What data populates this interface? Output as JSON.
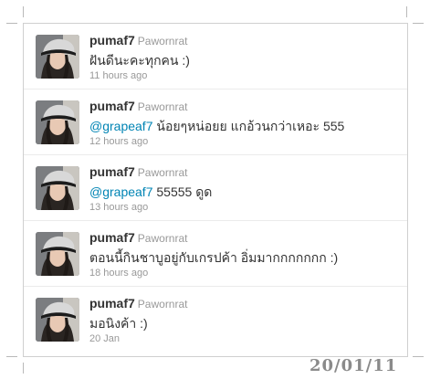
{
  "tweets": [
    {
      "username": "pumaf7",
      "full_name": "Pawornrat",
      "mention": "",
      "text": "ฝันดีนะคะทุกคน :)",
      "time": "11 hours ago"
    },
    {
      "username": "pumaf7",
      "full_name": "Pawornrat",
      "mention": "@grapeaf7",
      "text": " น้อยๆหน่อยย แกอ้วนกว่าเหอะ 555",
      "time": "12 hours ago"
    },
    {
      "username": "pumaf7",
      "full_name": "Pawornrat",
      "mention": "@grapeaf7",
      "text": " 55555 ดูด",
      "time": "13 hours ago"
    },
    {
      "username": "pumaf7",
      "full_name": "Pawornrat",
      "mention": "",
      "text": "ตอนนี้กินชาบูอยู่กับเกรปค้า อิ่มมากกกกกกก :)",
      "time": "18 hours ago"
    },
    {
      "username": "pumaf7",
      "full_name": "Pawornrat",
      "mention": "",
      "text": "มอนิงค้า :)",
      "time": "20 Jan"
    }
  ],
  "stamp": {
    "date": "20/01/11"
  },
  "colors": {
    "link": "#0084b4",
    "text": "#333333",
    "meta": "#999999"
  }
}
